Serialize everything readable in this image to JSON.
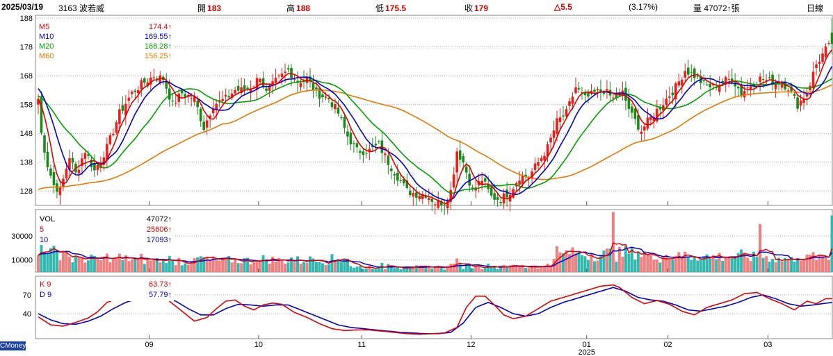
{
  "header": {
    "date": "2025/03/19",
    "stock": "3163 波若威",
    "open_label": "開",
    "open_value": "183",
    "high_label": "高",
    "high_value": "188",
    "low_label": "低",
    "low_value": "175.5",
    "close_label": "收",
    "close_value": "179",
    "change": "△5.5",
    "change_pct": "(3.17%)",
    "volume_label": "量",
    "volume_value": "47072↑張",
    "period": "日線"
  },
  "brand": "CMoney",
  "colors": {
    "up": "#e8201a",
    "down": "#1a8a1a",
    "ma5": "#e00000",
    "ma10": "#0000cc",
    "ma20": "#00a000",
    "ma60": "#e87800",
    "vol_up": "#f08080",
    "vol_down": "#33b8b0",
    "grid": "#aaaaaa",
    "border": "#888888"
  },
  "chart_data": [
    {
      "type": "candlestick",
      "panel": "price",
      "y_ticks": [
        128,
        138,
        148,
        158,
        168,
        178,
        188
      ],
      "ylim": [
        123,
        189
      ],
      "legend": [
        {
          "name": "M5",
          "value": "174.4↑",
          "color": "#e00000"
        },
        {
          "name": "M10",
          "value": "169.55↑",
          "color": "#0000cc"
        },
        {
          "name": "M20",
          "value": "168.28↑",
          "color": "#00a000"
        },
        {
          "name": "M60",
          "value": "156.25↑",
          "color": "#e87800"
        }
      ],
      "anchors": [
        [
          0,
          160
        ],
        [
          1,
          148
        ],
        [
          3,
          137
        ],
        [
          5,
          130
        ],
        [
          7,
          128
        ],
        [
          10,
          140
        ],
        [
          12,
          134
        ],
        [
          15,
          142
        ],
        [
          18,
          135
        ],
        [
          22,
          143
        ],
        [
          26,
          155
        ],
        [
          30,
          162
        ],
        [
          33,
          165
        ],
        [
          37,
          168
        ],
        [
          40,
          167
        ],
        [
          43,
          158
        ],
        [
          46,
          162
        ],
        [
          50,
          160
        ],
        [
          53,
          150
        ],
        [
          56,
          158
        ],
        [
          60,
          160
        ],
        [
          63,
          163
        ],
        [
          66,
          163
        ],
        [
          69,
          165
        ],
        [
          71,
          168
        ],
        [
          73,
          162
        ],
        [
          76,
          166
        ],
        [
          80,
          170
        ],
        [
          83,
          166
        ],
        [
          86,
          167
        ],
        [
          89,
          162
        ],
        [
          93,
          160
        ],
        [
          96,
          155
        ],
        [
          99,
          147
        ],
        [
          102,
          142
        ],
        [
          106,
          142
        ],
        [
          109,
          144
        ],
        [
          112,
          138
        ],
        [
          115,
          133
        ],
        [
          118,
          128
        ],
        [
          121,
          127
        ],
        [
          124,
          127
        ],
        [
          127,
          124
        ],
        [
          130,
          124
        ],
        [
          132,
          128
        ],
        [
          134,
          142
        ],
        [
          136,
          138
        ],
        [
          139,
          128
        ],
        [
          142,
          132
        ],
        [
          145,
          126
        ],
        [
          148,
          125
        ],
        [
          151,
          128
        ],
        [
          154,
          133
        ],
        [
          157,
          133
        ],
        [
          160,
          138
        ],
        [
          163,
          143
        ],
        [
          166,
          152
        ],
        [
          169,
          155
        ],
        [
          172,
          164
        ],
        [
          175,
          160
        ],
        [
          178,
          162
        ],
        [
          181,
          163
        ],
        [
          184,
          160
        ],
        [
          187,
          162
        ],
        [
          190,
          154
        ],
        [
          193,
          149
        ],
        [
          195,
          152
        ],
        [
          198,
          156
        ],
        [
          201,
          160
        ],
        [
          204,
          164
        ],
        [
          207,
          170
        ],
        [
          210,
          168
        ],
        [
          213,
          165
        ],
        [
          216,
          164
        ],
        [
          219,
          166
        ],
        [
          222,
          167
        ],
        [
          225,
          162
        ],
        [
          228,
          165
        ],
        [
          231,
          167
        ],
        [
          234,
          166
        ],
        [
          237,
          166
        ],
        [
          240,
          164
        ],
        [
          243,
          158
        ],
        [
          246,
          162
        ],
        [
          249,
          172
        ],
        [
          252,
          177
        ],
        [
          254,
          179
        ]
      ],
      "ma_seeds": {
        "ma10": 164,
        "ma20": 161,
        "ma60": 128
      }
    },
    {
      "type": "bar",
      "panel": "volume",
      "series_names": [
        "VOL",
        "5",
        "10"
      ],
      "legend": [
        {
          "name": "VOL",
          "value": "47072↑",
          "color": "#000000"
        },
        {
          "name": "5",
          "value": "25606↑",
          "color": "#e00000"
        },
        {
          "name": "10",
          "value": "17093↑",
          "color": "#0000cc"
        }
      ],
      "y_ticks": [
        10000,
        30000
      ],
      "ylim": [
        0,
        52000
      ],
      "last_value": 47072
    },
    {
      "type": "line",
      "panel": "kd",
      "legend": [
        {
          "name": "K 9",
          "value": "63.73↑",
          "color": "#e00000"
        },
        {
          "name": "D 9",
          "value": "57.79↑",
          "color": "#0000cc"
        }
      ],
      "y_ticks": [
        40,
        70
      ],
      "ylim": [
        0,
        100
      ],
      "k_anchors": [
        [
          0,
          35
        ],
        [
          4,
          22
        ],
        [
          8,
          20
        ],
        [
          12,
          26
        ],
        [
          16,
          33
        ],
        [
          19,
          43
        ],
        [
          22,
          58
        ],
        [
          26,
          65
        ],
        [
          30,
          70
        ],
        [
          34,
          68
        ],
        [
          38,
          72
        ],
        [
          42,
          60
        ],
        [
          46,
          44
        ],
        [
          50,
          28
        ],
        [
          54,
          34
        ],
        [
          57,
          48
        ],
        [
          60,
          60
        ],
        [
          63,
          62
        ],
        [
          66,
          52
        ],
        [
          69,
          46
        ],
        [
          72,
          54
        ],
        [
          75,
          57
        ],
        [
          78,
          55
        ],
        [
          82,
          42
        ],
        [
          86,
          34
        ],
        [
          90,
          24
        ],
        [
          94,
          16
        ],
        [
          98,
          13
        ],
        [
          102,
          14
        ],
        [
          106,
          14
        ],
        [
          110,
          12
        ],
        [
          114,
          10
        ],
        [
          118,
          8
        ],
        [
          122,
          7
        ],
        [
          126,
          8
        ],
        [
          130,
          9
        ],
        [
          134,
          18
        ],
        [
          137,
          50
        ],
        [
          140,
          68
        ],
        [
          143,
          68
        ],
        [
          146,
          54
        ],
        [
          149,
          38
        ],
        [
          152,
          32
        ],
        [
          156,
          36
        ],
        [
          160,
          48
        ],
        [
          164,
          60
        ],
        [
          168,
          66
        ],
        [
          172,
          72
        ],
        [
          176,
          78
        ],
        [
          180,
          84
        ],
        [
          184,
          86
        ],
        [
          186,
          82
        ],
        [
          190,
          66
        ],
        [
          194,
          56
        ],
        [
          198,
          61
        ],
        [
          202,
          55
        ],
        [
          206,
          44
        ],
        [
          210,
          38
        ],
        [
          214,
          50
        ],
        [
          218,
          56
        ],
        [
          222,
          62
        ],
        [
          226,
          72
        ],
        [
          230,
          74
        ],
        [
          234,
          64
        ],
        [
          238,
          56
        ],
        [
          242,
          46
        ],
        [
          246,
          60
        ],
        [
          249,
          56
        ],
        [
          252,
          64
        ],
        [
          254,
          64
        ]
      ],
      "d_anchors": [
        [
          0,
          40
        ],
        [
          4,
          30
        ],
        [
          8,
          24
        ],
        [
          12,
          23
        ],
        [
          16,
          28
        ],
        [
          20,
          36
        ],
        [
          24,
          48
        ],
        [
          28,
          58
        ],
        [
          32,
          64
        ],
        [
          36,
          66
        ],
        [
          40,
          66
        ],
        [
          44,
          60
        ],
        [
          48,
          48
        ],
        [
          52,
          38
        ],
        [
          56,
          38
        ],
        [
          60,
          48
        ],
        [
          64,
          55
        ],
        [
          68,
          54
        ],
        [
          72,
          52
        ],
        [
          76,
          54
        ],
        [
          80,
          54
        ],
        [
          84,
          46
        ],
        [
          88,
          38
        ],
        [
          92,
          30
        ],
        [
          96,
          22
        ],
        [
          100,
          18
        ],
        [
          104,
          16
        ],
        [
          108,
          14
        ],
        [
          112,
          12
        ],
        [
          116,
          10
        ],
        [
          120,
          9
        ],
        [
          124,
          8
        ],
        [
          128,
          8
        ],
        [
          132,
          10
        ],
        [
          136,
          25
        ],
        [
          140,
          50
        ],
        [
          144,
          58
        ],
        [
          148,
          50
        ],
        [
          152,
          40
        ],
        [
          156,
          36
        ],
        [
          160,
          40
        ],
        [
          164,
          50
        ],
        [
          168,
          58
        ],
        [
          172,
          64
        ],
        [
          176,
          70
        ],
        [
          180,
          76
        ],
        [
          184,
          82
        ],
        [
          188,
          76
        ],
        [
          192,
          66
        ],
        [
          196,
          62
        ],
        [
          200,
          60
        ],
        [
          204,
          54
        ],
        [
          208,
          46
        ],
        [
          212,
          44
        ],
        [
          216,
          48
        ],
        [
          220,
          52
        ],
        [
          224,
          58
        ],
        [
          228,
          66
        ],
        [
          232,
          70
        ],
        [
          236,
          64
        ],
        [
          240,
          56
        ],
        [
          244,
          52
        ],
        [
          248,
          54
        ],
        [
          251,
          56
        ],
        [
          254,
          58
        ]
      ]
    }
  ],
  "x_axis": {
    "months": [
      {
        "label": "09",
        "bar": 36
      },
      {
        "label": "10",
        "bar": 71
      },
      {
        "label": "11",
        "bar": 104
      },
      {
        "label": "12",
        "bar": 139
      },
      {
        "label": "01",
        "bar": 176
      },
      {
        "label": "02",
        "bar": 202
      },
      {
        "label": "03",
        "bar": 234
      }
    ],
    "year_label": "2025",
    "year_bar": 176,
    "bar_count": 255
  }
}
